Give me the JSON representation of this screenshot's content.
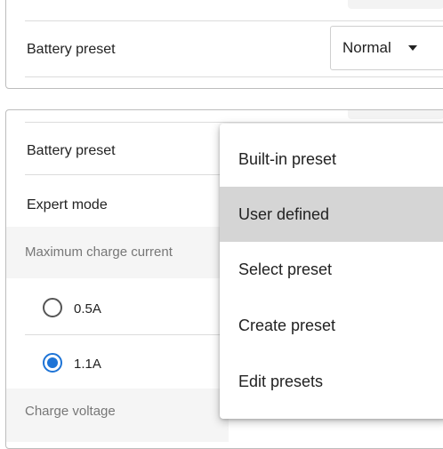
{
  "card1": {
    "battery_preset_label": "Battery preset",
    "battery_preset_value": "Normal"
  },
  "card2": {
    "battery_preset_label": "Battery preset",
    "expert_mode_label": "Expert mode",
    "max_charge_current_header": "Maximum charge current",
    "current_options": [
      {
        "label": "0.5A",
        "selected": false
      },
      {
        "label": "1.1A",
        "selected": true
      }
    ],
    "charge_voltage_header": "Charge voltage"
  },
  "menu": {
    "items": [
      {
        "label": "Built-in preset",
        "selected": false
      },
      {
        "label": "User defined",
        "selected": true
      },
      {
        "label": "Select preset",
        "selected": false
      },
      {
        "label": "Create preset",
        "selected": false
      },
      {
        "label": "Edit presets",
        "selected": false
      }
    ]
  },
  "colors": {
    "accent": "#1e74d6",
    "menu_selected": "#d5d5d5",
    "section_header_bg": "#f5f5f5"
  }
}
